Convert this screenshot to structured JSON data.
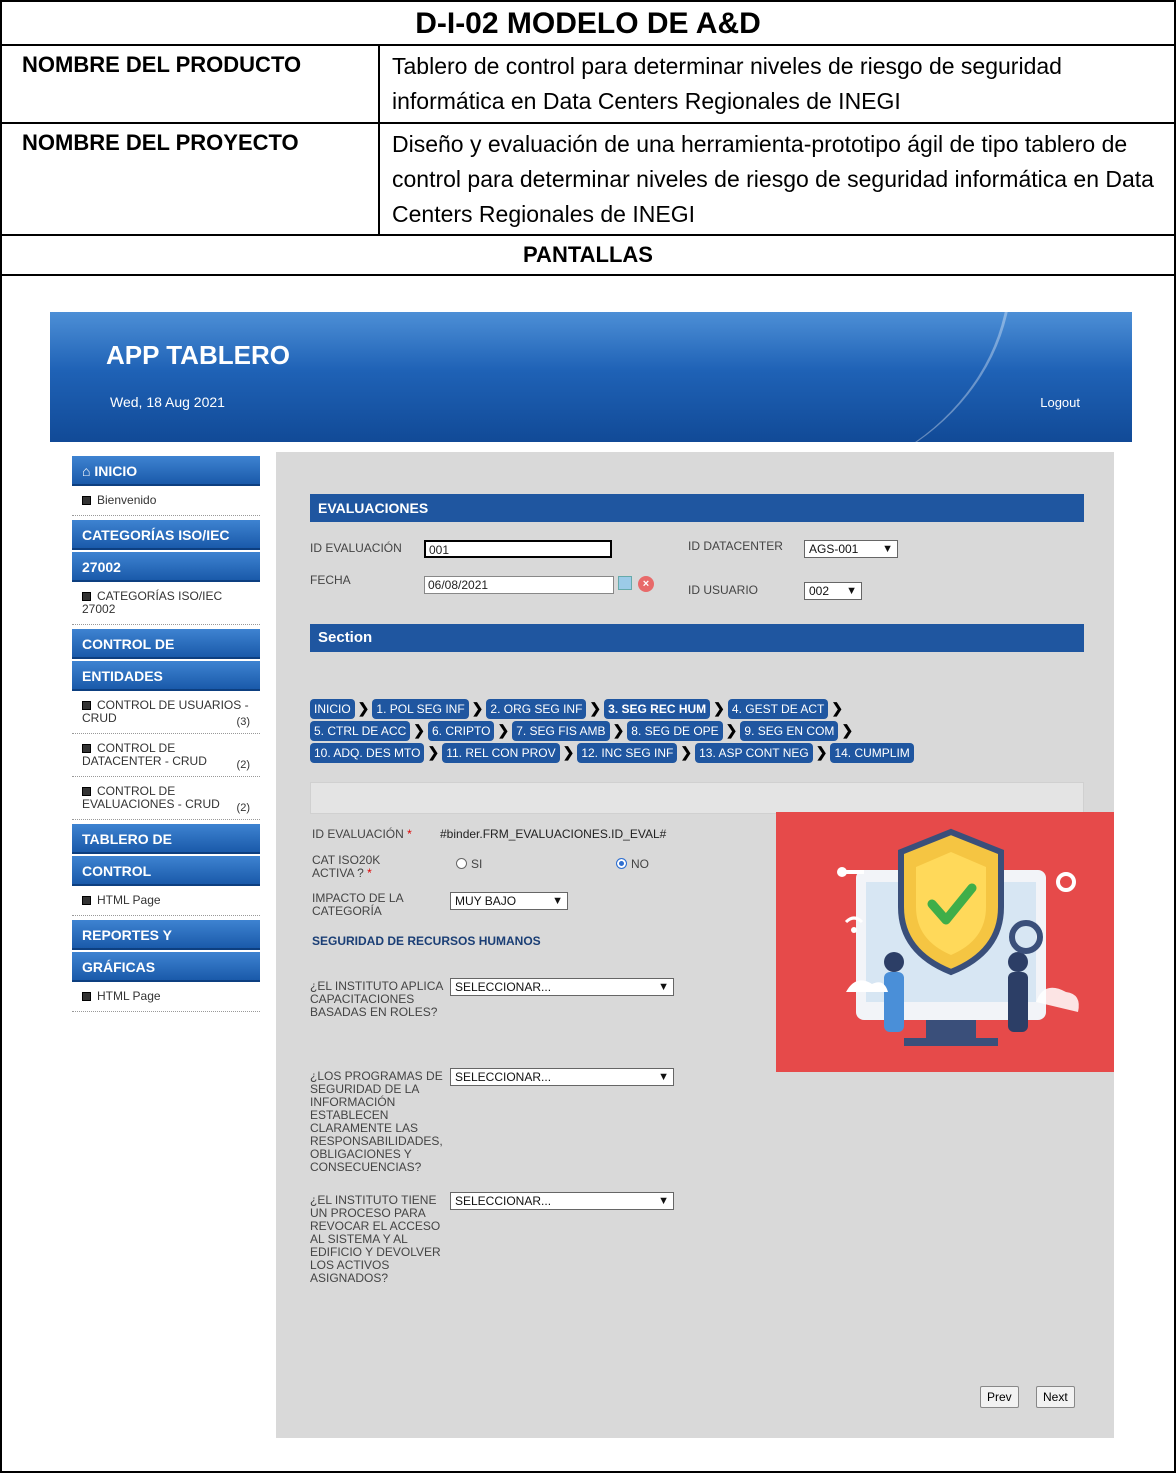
{
  "doc": {
    "title": "D-I-02 MODELO DE A&D",
    "product_key": "NOMBRE DEL PRODUCTO",
    "product_val": "Tablero de control para determinar niveles de riesgo de seguridad informática en Data Centers Regionales de INEGI",
    "project_key": "NOMBRE DEL PROYECTO",
    "project_val": "Diseño y evaluación de una herramienta-prototipo ágil de tipo tablero de control para determinar niveles de riesgo de seguridad informática en Data Centers Regionales de INEGI",
    "screens_heading": "PANTALLAS"
  },
  "app": {
    "title": "APP TABLERO",
    "date": "Wed, 18 Aug 2021",
    "logout": "Logout",
    "colors": {
      "header": "#1f62b6",
      "bar": "#1f56a0",
      "illustration": "#e64a4a"
    }
  },
  "sidebar": {
    "inicio": "INICIO",
    "bienvenido": "Bienvenido",
    "cat_head1": "CATEGORÍAS ISO/IEC",
    "cat_head2": "27002",
    "cat_item": "CATEGORÍAS ISO/IEC 27002",
    "ctrl_head1": "CONTROL DE",
    "ctrl_head2": "ENTIDADES",
    "ctrl_usuarios": "CONTROL DE USUARIOS - CRUD",
    "ctrl_usuarios_cnt": "(3)",
    "ctrl_datacenter": "CONTROL DE DATACENTER - CRUD",
    "ctrl_datacenter_cnt": "(2)",
    "ctrl_evaluaciones": "CONTROL DE EVALUACIONES - CRUD",
    "ctrl_evaluaciones_cnt": "(2)",
    "tab_head1": "TABLERO DE",
    "tab_head2": "CONTROL",
    "tab_item": "HTML Page",
    "rep_head1": "REPORTES Y",
    "rep_head2": "GRÁFICAS",
    "rep_item": "HTML Page"
  },
  "form": {
    "section_title": "EVALUACIONES",
    "id_eval_label": "ID EVALUACIÓN",
    "id_eval_value": "001",
    "fecha_label": "FECHA",
    "fecha_value": "06/08/2021",
    "id_datacenter_label": "ID DATACENTER",
    "id_datacenter_value": "AGS-001",
    "id_usuario_label": "ID USUARIO",
    "id_usuario_value": "002",
    "section2_title": "Section",
    "tabs": [
      "INICIO",
      "1. POL SEG INF",
      "2. ORG SEG INF",
      "3. SEG REC HUM",
      "4. GEST DE ACT",
      "5. CTRL DE ACC",
      "6. CRIPTO",
      "7. SEG FIS AMB",
      "8. SEG DE OPE",
      "9. SEG EN COM",
      "10. ADQ. DES MTO",
      "11. REL CON PROV",
      "12. INC SEG INF",
      "13. ASP CONT NEG",
      "14. CUMPLIM"
    ],
    "id_eval2_label": "ID EVALUACIÓN",
    "id_eval2_value": "#binder.FRM_EVALUACIONES.ID_EVAL#",
    "cat_activa_label": "CAT ISO20K ACTIVA ?",
    "opt_si": "SI",
    "opt_no": "NO",
    "impacto_label": "IMPACTO DE LA CATEGORÍA",
    "impacto_value": "MUY BAJO",
    "subheading": "SEGURIDAD DE RECURSOS HUMANOS",
    "q1": "¿EL INSTITUTO APLICA CAPACITACIONES BASADAS EN ROLES?",
    "q2": "¿LOS PROGRAMAS DE SEGURIDAD DE LA INFORMACIÓN ESTABLECEN CLARAMENTE LAS RESPONSABILIDADES, OBLIGACIONES Y CONSECUENCIAS?",
    "q3": "¿EL INSTITUTO TIENE UN PROCESO PARA REVOCAR EL ACCESO AL SISTEMA Y AL EDIFICIO Y DEVOLVER LOS ACTIVOS ASIGNADOS?",
    "select_placeholder": "SELECCIONAR...",
    "prev": "Prev",
    "next": "Next"
  }
}
